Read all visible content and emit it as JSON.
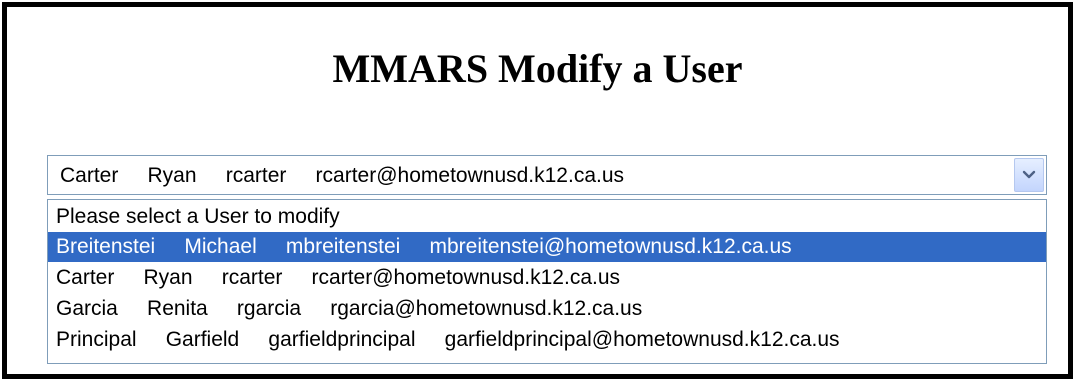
{
  "page": {
    "title": "MMARS Modify a User"
  },
  "user_select": {
    "selected_value": "Carter     Ryan     rcarter     rcarter@hometownusd.k12.ca.us",
    "dropdown_icon": "chevron-down-icon",
    "highlighted_index": 1,
    "options": [
      {
        "label": "Please select a User to modify"
      },
      {
        "label": "Breitenstei     Michael     mbreitenstei     mbreitenstei@hometownusd.k12.ca.us"
      },
      {
        "label": "Carter     Ryan     rcarter     rcarter@hometownusd.k12.ca.us"
      },
      {
        "label": "Garcia     Renita     rgarcia     rgarcia@hometownusd.k12.ca.us"
      },
      {
        "label": "Principal     Garfield     garfieldprincipal     garfieldprincipal@hometownusd.k12.ca.us"
      }
    ]
  },
  "colors": {
    "highlight": "#316ac5",
    "border": "#7f9db9",
    "frame": "#000000"
  }
}
